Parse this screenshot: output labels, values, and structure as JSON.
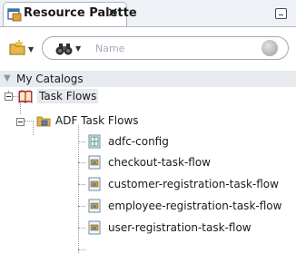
{
  "window": {
    "tab_title": "Resource Palette",
    "close_glyph": "✕"
  },
  "icons": {
    "tab": "resource-palette-icon",
    "new": "new-folder-icon",
    "search_type": "binoculars-icon",
    "search_go": "search-go-icon",
    "catalog": "book-icon",
    "folder": "adf-folder-icon",
    "config": "config-file-icon",
    "task_flow": "task-flow-file-icon"
  },
  "search": {
    "placeholder": "Name",
    "value": ""
  },
  "catalogs": {
    "header": "My Catalogs"
  },
  "tree": {
    "root": "Task Flows",
    "folder": "ADF Task Flows",
    "items": [
      "adfc-config",
      "checkout-task-flow",
      "customer-registration-task-flow",
      "employee-registration-task-flow",
      "user-registration-task-flow"
    ]
  },
  "colors": {
    "accent": "#a9b6c6",
    "selection": "#e6e9ee",
    "folder": "#d9a63a"
  }
}
